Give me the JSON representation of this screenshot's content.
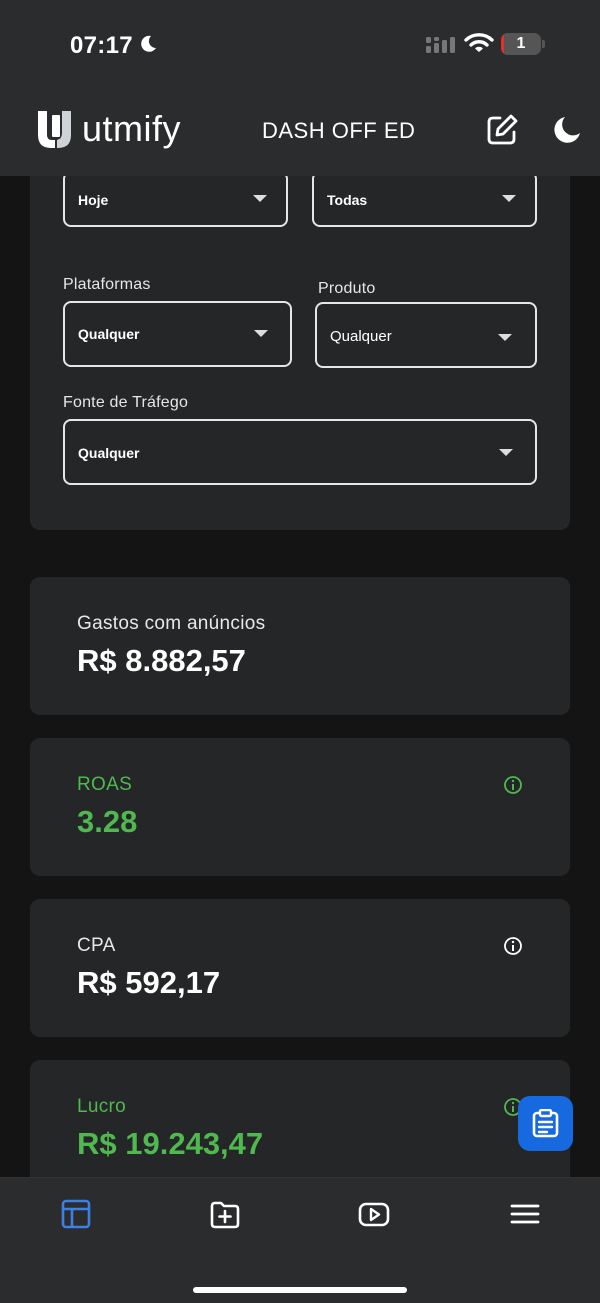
{
  "status_bar": {
    "time": "07:17",
    "battery": "1"
  },
  "header": {
    "logo_text": "utmify",
    "title": "DASH OFF ED"
  },
  "filters": {
    "period": {
      "value": "Hoje"
    },
    "account": {
      "value": "Todas"
    },
    "platforms": {
      "label": "Plataformas",
      "value": "Qualquer"
    },
    "product": {
      "label": "Produto",
      "value": "Qualquer"
    },
    "traffic_source": {
      "label": "Fonte de Tráfego",
      "value": "Qualquer"
    }
  },
  "metrics": [
    {
      "label": "Gastos com anúncios",
      "value": "R$ 8.882,57"
    },
    {
      "label": "ROAS",
      "value": "3.28"
    },
    {
      "label": "CPA",
      "value": "R$ 592,17"
    },
    {
      "label": "Lucro",
      "value": "R$ 19.243,47"
    }
  ],
  "colors": {
    "accent": "#1769e0",
    "positive": "#4fb94f",
    "background": "#141414",
    "card": "#252627"
  },
  "icons": [
    "moon-icon",
    "signal-icon",
    "wifi-icon",
    "battery-icon",
    "utmify-logo",
    "edit-icon",
    "theme-toggle-icon",
    "info-icon",
    "clipboard-icon",
    "dashboard-icon",
    "folder-add-icon",
    "video-icon",
    "menu-icon"
  ]
}
